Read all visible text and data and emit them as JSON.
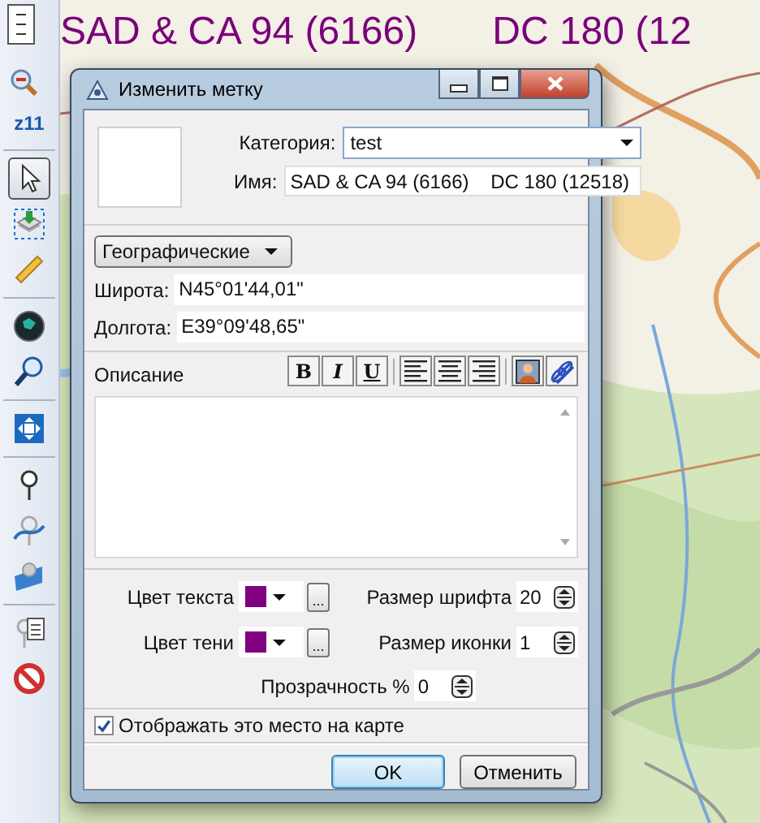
{
  "map_labels": [
    {
      "text": "SAD & CA 94 (6166)"
    },
    {
      "text": "DC 180 (12"
    }
  ],
  "toolbar": {
    "zoom_level": "z11",
    "tools": [
      {
        "kind": "select",
        "selected": true
      },
      {
        "kind": "layer",
        "selected": false
      },
      {
        "kind": "ruler",
        "selected": false
      },
      {
        "kind": "globe",
        "selected": false
      },
      {
        "kind": "magnifier",
        "selected": false
      },
      {
        "kind": "fit",
        "selected": false
      },
      {
        "kind": "pin",
        "selected": false
      },
      {
        "kind": "path",
        "selected": false
      },
      {
        "kind": "polygon",
        "selected": false
      },
      {
        "kind": "notes",
        "selected": false
      },
      {
        "kind": "forbid",
        "selected": false
      }
    ]
  },
  "dialog": {
    "title": "Изменить метку",
    "category": {
      "label": "Категория:",
      "value": "test"
    },
    "name": {
      "label": "Имя:",
      "value": "SAD & CA 94 (6166)    DC 180 (12518)"
    },
    "coordinate_format": "Географические",
    "latitude": {
      "label": "Широта:",
      "value": "N45°01'44,01\""
    },
    "longitude": {
      "label": "Долгота:",
      "value": "E39°09'48,65\""
    },
    "description": {
      "label": "Описание"
    },
    "format_buttons": [
      "B",
      "I",
      "U"
    ],
    "color_pickers": [
      {
        "label": "Цвет текста",
        "color": "#800080",
        "browse_label": "..."
      },
      {
        "label": "Цвет тени",
        "color": "#800080",
        "browse_label": "..."
      }
    ],
    "spinners": [
      {
        "label": "Размер шрифта",
        "value": "20"
      },
      {
        "label": "Размер иконки",
        "value": "1"
      },
      {
        "label": "Прозрачность %",
        "value": "0"
      }
    ],
    "show_on_map": {
      "label": "Отображать это место на карте",
      "checked": true
    },
    "buttons": [
      {
        "label": "OK",
        "default": true
      },
      {
        "label": "Отменить",
        "default": false
      }
    ]
  }
}
